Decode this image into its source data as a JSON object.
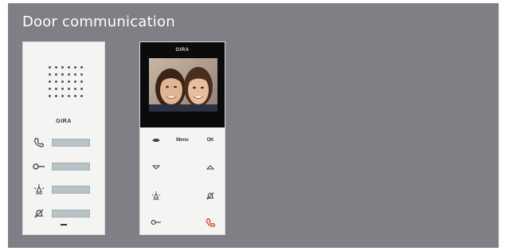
{
  "header": {
    "title": "Door communication"
  },
  "audio_station": {
    "logo": "GIRA",
    "buttons": [
      {
        "icon": "handset-icon"
      },
      {
        "icon": "key-icon"
      },
      {
        "icon": "light-icon"
      },
      {
        "icon": "bell-mute-icon"
      }
    ]
  },
  "video_station": {
    "logo": "GIRA",
    "labels": {
      "menu": "Menu",
      "ok": "OK"
    },
    "icons": [
      "internal-call-icon",
      "down-arrow-icon",
      "up-arrow-icon",
      "light-icon",
      "bell-mute-icon",
      "key-icon",
      "handset-icon"
    ]
  },
  "colors": {
    "panel": "#7f7f86",
    "device": "#f4f4f2",
    "button": "#b8c3c7",
    "handset_accent": "#e0422a"
  }
}
